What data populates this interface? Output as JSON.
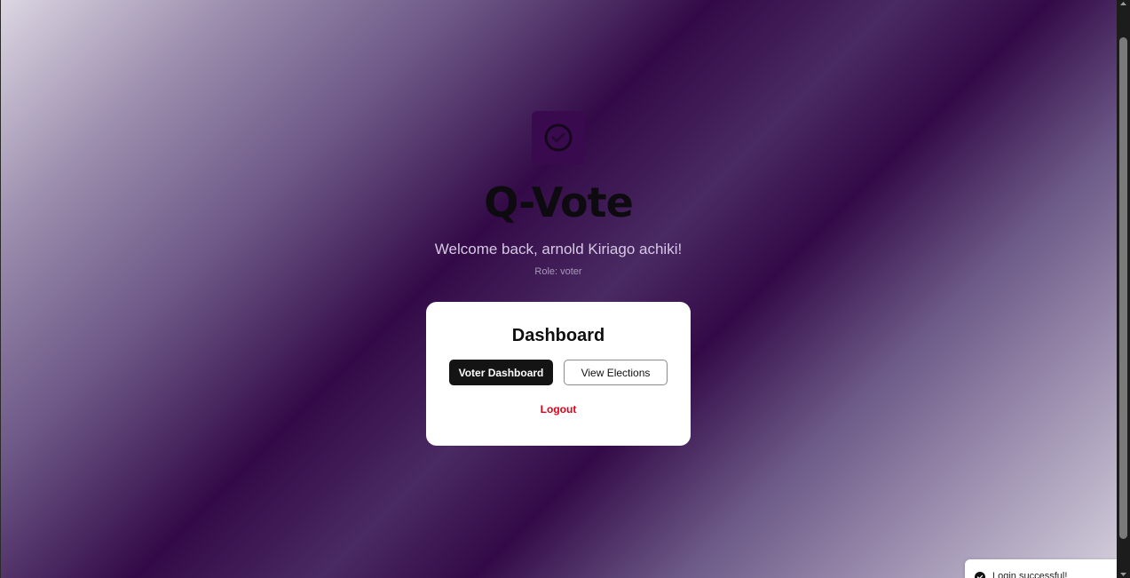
{
  "app": {
    "title": "Q-Vote",
    "logo_icon": "vote-ring-icon",
    "welcome": "Welcome back, arnold Kiriago achiki!",
    "role": "Role: voter"
  },
  "dashboard": {
    "title": "Dashboard",
    "voter_dashboard_label": "Voter Dashboard",
    "view_elections_label": "View Elections",
    "logout_label": "Logout"
  },
  "toast": {
    "message": "Login successful!",
    "icon": "check-circle-icon"
  },
  "colors": {
    "brand": "#3a0a4f",
    "primary_button": "#141414",
    "logout": "#e0001a"
  }
}
